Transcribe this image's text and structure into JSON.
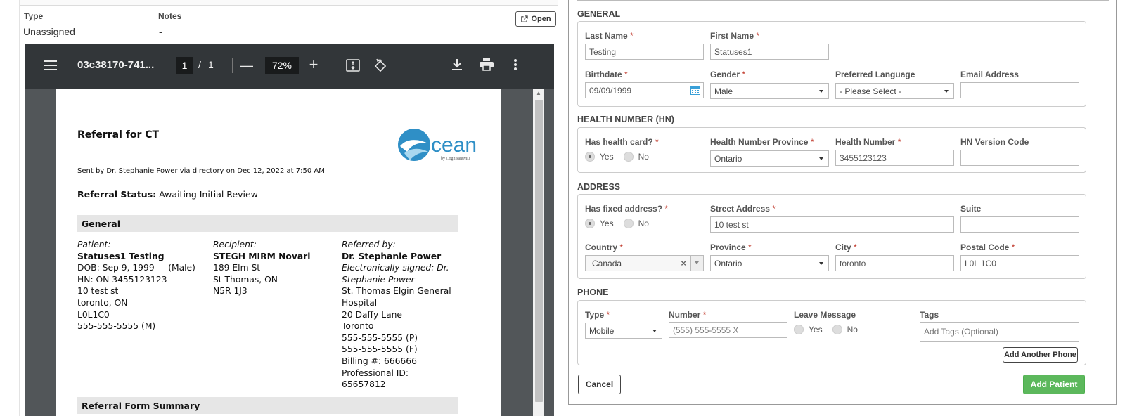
{
  "left": {
    "type_label": "Type",
    "type_value": "Unassigned",
    "notes_label": "Notes",
    "notes_value": "-",
    "open_label": "Open"
  },
  "viewer": {
    "doc_title": "03c38170-741...",
    "page_current": "1",
    "page_sep": "/",
    "page_total": "1",
    "zoom": "72%",
    "minus": "—",
    "plus": "+"
  },
  "doc": {
    "title": "Referral for CT",
    "sent_by": "Sent by Dr. Stephanie Power via directory on Dec 12, 2022 at 7:50 AM",
    "status_label": "Referral Status:",
    "status_value": "Awaiting Initial Review",
    "general_header": "General",
    "form_summary_header": "Referral Form Summary",
    "logo_text": "cean",
    "logo_sub": "by CognisantMD",
    "patient": {
      "label": "Patient:",
      "name": "Statuses1 Testing",
      "dob": "DOB: Sep 9, 1999     (Male)",
      "hn": "HN: ON 3455123123",
      "street": "10 test st",
      "city": "toronto, ON",
      "postal": "L0L1C0",
      "phone": "555-555-5555 (M)"
    },
    "recipient": {
      "label": "Recipient:",
      "name": "STEGH MIRM Novari",
      "street": "189 Elm St",
      "city": "St Thomas, ON",
      "postal": "N5R 1J3"
    },
    "referrer": {
      "label": "Referred by:",
      "name": "Dr. Stephanie Power",
      "signed_1": "Electronically signed: Dr.",
      "signed_2": "Stephanie Power",
      "org_1": "St. Thomas Elgin General",
      "org_2": "Hospital",
      "street": "20 Daffy Lane",
      "city": "Toronto",
      "phone": "555-555-5555 (P)",
      "fax": "555-555-5555 (F)",
      "billing": "Billing #: 666666",
      "prof_id": "Professional ID: 65657812"
    }
  },
  "form": {
    "general_title": "GENERAL",
    "last_name_label": "Last Name",
    "last_name_value": "Testing",
    "first_name_label": "First Name",
    "first_name_value": "Statuses1",
    "birthdate_label": "Birthdate",
    "birthdate_value": "09/09/1999",
    "gender_label": "Gender",
    "gender_value": "Male",
    "language_label": "Preferred Language",
    "language_value": "- Please Select -",
    "email_label": "Email Address",
    "email_value": "",
    "hn_title": "HEALTH NUMBER (HN)",
    "has_card_label": "Has health card?",
    "yes": "Yes",
    "no": "No",
    "hn_province_label": "Health Number Province",
    "hn_province_value": "Ontario",
    "hn_label": "Health Number",
    "hn_value": "3455123123",
    "hn_version_label": "HN Version Code",
    "hn_version_value": "",
    "address_title": "ADDRESS",
    "fixed_label": "Has fixed address?",
    "street_label": "Street Address",
    "street_value": "10 test st",
    "suite_label": "Suite",
    "suite_value": "",
    "country_label": "Country",
    "country_value": "Canada",
    "province_label": "Province",
    "province_value": "Ontario",
    "city_label": "City",
    "city_value": "toronto",
    "postal_label": "Postal Code",
    "postal_value": "L0L 1C0",
    "phone_title": "PHONE",
    "phone_type_label": "Type",
    "phone_type_value": "Mobile",
    "number_label": "Number",
    "number_placeholder": "(555) 555-5555 X",
    "leave_msg_label": "Leave Message",
    "tags_label": "Tags",
    "tags_placeholder": "Add Tags (Optional)",
    "add_phone": "Add Another Phone",
    "cancel": "Cancel",
    "add_patient": "Add Patient",
    "required_mark": "*"
  }
}
